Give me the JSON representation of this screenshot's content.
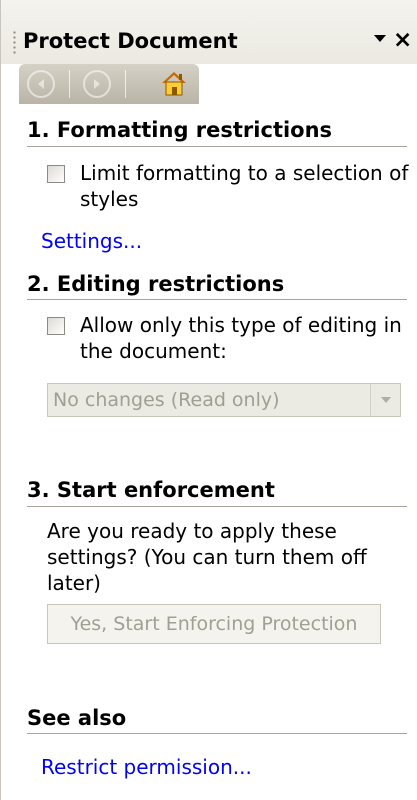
{
  "pane": {
    "title": "Protect Document"
  },
  "nav": {
    "back_icon": "back-arrow-circle",
    "forward_icon": "forward-arrow-circle",
    "home_icon": "house"
  },
  "formatting": {
    "header": "1. Formatting restrictions",
    "checkbox_label_line1": "Limit formatting to a selection of",
    "checkbox_label_line2": "styles",
    "checked": false,
    "settings_link": "Settings..."
  },
  "editing": {
    "header": "2. Editing restrictions",
    "checkbox_label_line1": "Allow only this type of editing in",
    "checkbox_label_line2": "the document:",
    "checked": false,
    "selected_option": "No changes (Read only)"
  },
  "enforcement": {
    "header": "3. Start enforcement",
    "prompt_line1": "Are you ready to apply these",
    "prompt_line2": "settings? (You can turn them off",
    "prompt_line3": "later)",
    "button_label": "Yes, Start Enforcing Protection"
  },
  "see_also": {
    "header": "See also",
    "restrict_link": "Restrict permission..."
  },
  "colors": {
    "link": "#0000ff",
    "disabled_text": "#a19e92",
    "nav_bar": "#c7c3b7",
    "home_roof": "#cc6600",
    "home_body": "#ffcc33"
  }
}
